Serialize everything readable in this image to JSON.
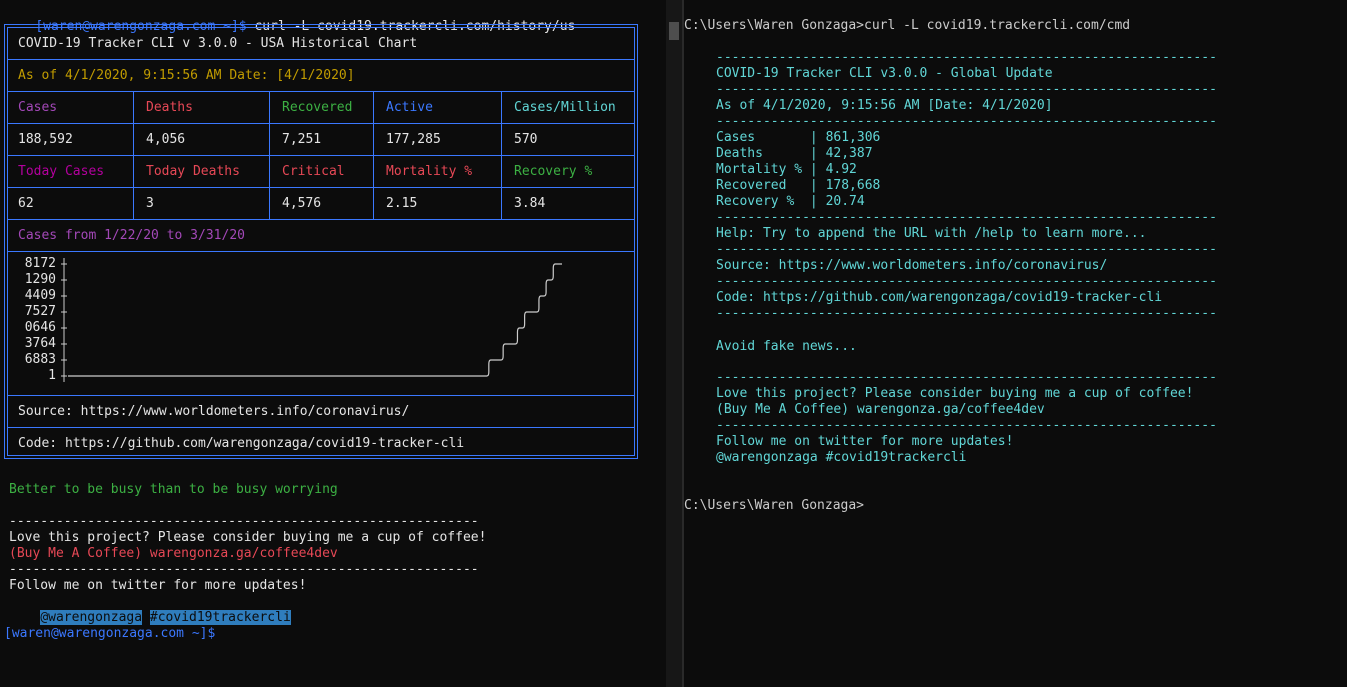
{
  "left": {
    "prompt": "[waren@warengonzaga.com ~]$",
    "command": " curl -L covid19.trackercli.com/history/us",
    "table": {
      "title": "COVID-19 Tracker CLI v 3.0.0 - USA Historical Chart",
      "as_of": "As of 4/1/2020, 9:15:56 AM Date: [4/1/2020]",
      "row1_headers": [
        "Cases",
        "Deaths",
        "Recovered",
        "Active",
        "Cases/Million"
      ],
      "row1_values": [
        "188,592",
        "4,056",
        "7,251",
        "177,285",
        "570"
      ],
      "row2_headers": [
        "Today Cases",
        "Today Deaths",
        "Critical",
        "Mortality %",
        "Recovery %"
      ],
      "row2_values": [
        "62",
        "3",
        "4,576",
        "2.15",
        "3.84"
      ],
      "chart_label": "Cases from 1/22/20 to 3/31/20",
      "source": "Source: https://www.worldometers.info/coronavirus/",
      "code": "Code: https://github.com/warengonzaga/covid19-tracker-cli"
    },
    "motto": "Better to be busy than to be busy worrying",
    "separator": "------------------------------------------------------------",
    "love": "Love this project? Please consider buying me a cup of coffee!",
    "coffee": "(Buy Me A Coffee) warengonza.ga/coffee4dev",
    "follow": "Follow me on twitter for more updates!",
    "handle": "@warengonzaga",
    "hashtag": "#covid19trackercli",
    "final_prompt": "[waren@warengonzaga.com ~]$"
  },
  "right": {
    "command_line": "C:\\Users\\Waren Gonzaga>curl -L covid19.trackercli.com/cmd",
    "separator": "----------------------------------------------------------------",
    "title": "COVID-19 Tracker CLI v3.0.0 - Global Update",
    "as_of": "As of 4/1/2020, 9:15:56 AM [Date: 4/1/2020]",
    "stats": [
      {
        "label": "Cases       ",
        "value": "861,306"
      },
      {
        "label": "Deaths      ",
        "value": "42,387"
      },
      {
        "label": "Mortality % ",
        "value": "4.92"
      },
      {
        "label": "Recovered   ",
        "value": "178,668"
      },
      {
        "label": "Recovery %  ",
        "value": "20.74"
      }
    ],
    "help": "Help: Try to append the URL with /help to learn more...",
    "source": "Source: https://www.worldometers.info/coronavirus/",
    "code": "Code: https://github.com/warengonzaga/covid19-tracker-cli",
    "avoid": "Avoid fake news...",
    "love": "Love this project? Please consider buying me a cup of coffee!",
    "coffee": "(Buy Me A Coffee) warengonza.ga/coffee4dev",
    "follow": "Follow me on twitter for more updates!",
    "handle_line": "@warengonzaga #covid19trackercli",
    "final_prompt": "C:\\Users\\Waren Gonzaga>"
  },
  "chart_data": {
    "type": "line",
    "title": "Cases from 1/22/20 to 3/31/20",
    "y_tick_labels": [
      "8172",
      "1290",
      "4409",
      "7527",
      "0646",
      "3764",
      "6883",
      "1"
    ],
    "y_steps_profile": [
      0,
      0,
      0,
      0,
      0,
      0,
      0,
      0,
      0,
      0,
      0,
      0,
      0,
      0,
      0,
      0,
      0,
      0,
      0,
      0,
      0,
      0,
      0,
      0,
      0,
      0,
      0,
      0,
      0,
      0,
      0,
      0,
      0,
      0,
      0,
      0,
      0,
      0,
      0,
      0,
      0,
      0,
      0,
      0,
      0,
      0,
      0,
      0,
      0,
      0,
      0,
      0,
      0,
      0,
      0,
      0,
      0,
      0,
      0,
      1,
      1,
      2,
      2,
      3,
      4,
      4,
      5,
      6,
      7,
      7
    ]
  },
  "colors": {
    "background": "#0c0c0c",
    "border": "#3b78ff",
    "cases": "#a348b8",
    "deaths": "#e74856",
    "recovered": "#3cb043",
    "active": "#3b78ff",
    "cases_per_million": "#61d6d6",
    "as_of": "#c19c00",
    "selection": "#2f7dbd"
  }
}
